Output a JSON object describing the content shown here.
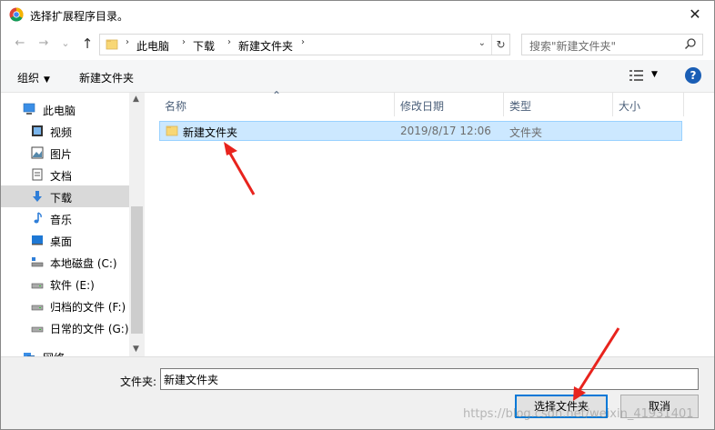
{
  "window": {
    "title": "选择扩展程序目录。",
    "close_glyph": "✕"
  },
  "nav": {
    "back": "←",
    "forward": "→",
    "recent": "⌄",
    "up": "↑"
  },
  "address": {
    "crumbs": [
      "此电脑",
      "下载",
      "新建文件夹"
    ],
    "separator": "›",
    "dropdown": "⌄",
    "refresh": "↻"
  },
  "search": {
    "placeholder": "搜索\"新建文件夹\""
  },
  "toolbar": {
    "organize_label": "组织",
    "organize_caret": "▼",
    "new_folder_label": "新建文件夹",
    "view_caret": "▼",
    "help_label": "?"
  },
  "sidebar": {
    "items": [
      {
        "label": "此电脑",
        "icon": "computer-icon",
        "top": true
      },
      {
        "label": "视频",
        "icon": "video-icon"
      },
      {
        "label": "图片",
        "icon": "picture-icon"
      },
      {
        "label": "文档",
        "icon": "document-icon"
      },
      {
        "label": "下载",
        "icon": "download-icon",
        "selected": true
      },
      {
        "label": "音乐",
        "icon": "music-icon"
      },
      {
        "label": "桌面",
        "icon": "desktop-icon"
      },
      {
        "label": "本地磁盘 (C:)",
        "icon": "drive-c-icon"
      },
      {
        "label": "软件 (E:)",
        "icon": "drive-icon"
      },
      {
        "label": "归档的文件 (F:)",
        "icon": "drive-icon"
      },
      {
        "label": "日常的文件 (G:)",
        "icon": "drive-icon"
      },
      {
        "label": "网络",
        "icon": "network-icon",
        "top": true
      }
    ],
    "scroll_up": "▲",
    "scroll_down": "▼"
  },
  "columns": {
    "name": "名称",
    "date": "修改日期",
    "type": "类型",
    "size": "大小",
    "sort_caret": "⌃"
  },
  "files": [
    {
      "name": "新建文件夹",
      "date": "2019/8/17 12:06",
      "type": "文件夹",
      "selected": true
    }
  ],
  "footer": {
    "folder_label": "文件夹:",
    "folder_value": "新建文件夹",
    "select_button": "选择文件夹",
    "cancel_button": "取消",
    "watermark": "https://blog.csdn.net/weixin_41931401"
  },
  "colors": {
    "accent": "#0078d7",
    "selection": "#cce8ff",
    "arrow": "#e8231d",
    "folder": "#f8d775"
  }
}
